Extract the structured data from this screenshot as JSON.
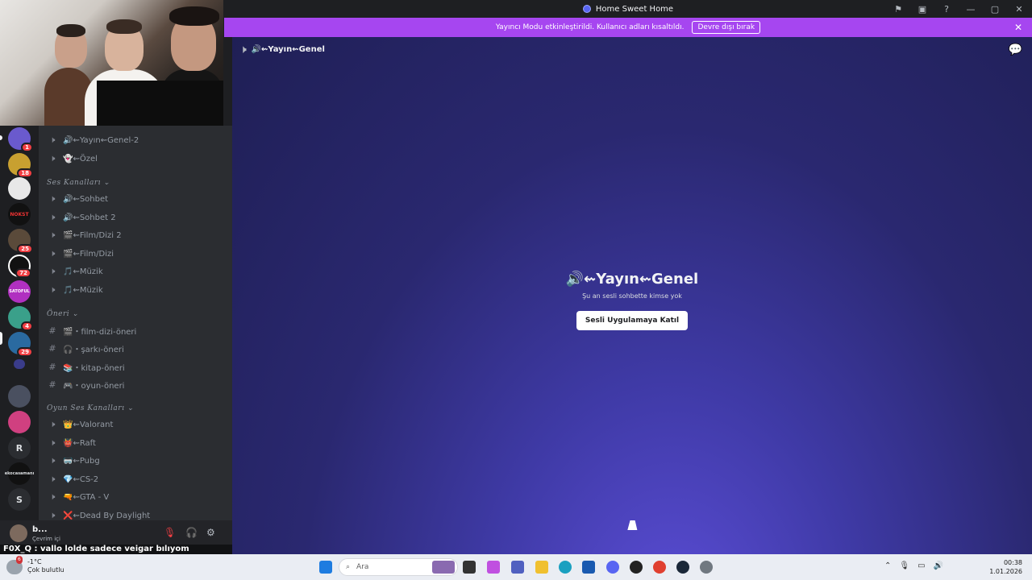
{
  "window": {
    "title": "Home Sweet Home"
  },
  "banner": {
    "text": "Yayıncı Modu etkinleştirildi. Kullanıcı adları kısaltıldı.",
    "button": "Devre dışı bırak"
  },
  "sidebar": {
    "channels_top": [
      {
        "icon": "speaker-icon",
        "label": "🔊⇜Yayın⇜Genel-2"
      },
      {
        "icon": "speaker-icon",
        "label": "👻⇜Özel"
      }
    ],
    "categories": [
      {
        "name": "Ses Kanalları",
        "channels": [
          {
            "icon": "speaker-icon",
            "label": "🔊⇜Sohbet"
          },
          {
            "icon": "speaker-icon",
            "label": "🔊⇜Sohbet 2"
          },
          {
            "icon": "speaker-icon",
            "label": "🎬⇜Film/Dizi 2"
          },
          {
            "icon": "speaker-icon",
            "label": "🎬⇜Film/Dizi"
          },
          {
            "icon": "speaker-icon",
            "label": "🎵⇜Müzik"
          },
          {
            "icon": "speaker-icon",
            "label": "🎵⇜Müzik"
          }
        ]
      },
      {
        "name": "Öneri",
        "channels": [
          {
            "icon": "hash-icon",
            "label": "🎬・film-dizi-öneri"
          },
          {
            "icon": "hash-icon",
            "label": "🎧・şarkı-öneri"
          },
          {
            "icon": "hash-icon",
            "label": "📚・kitap-öneri"
          },
          {
            "icon": "hash-icon",
            "label": "🎮・oyun-öneri"
          }
        ]
      },
      {
        "name": "Oyun Ses Kanalları",
        "channels": [
          {
            "icon": "speaker-icon",
            "label": "👑⇜Valorant"
          },
          {
            "icon": "speaker-icon",
            "label": "👹⇜Raft"
          },
          {
            "icon": "speaker-icon",
            "label": "🥽⇜Pubg"
          },
          {
            "icon": "speaker-icon",
            "label": "💎⇜CS-2"
          },
          {
            "icon": "speaker-icon",
            "label": "🔫⇜GTA - V"
          },
          {
            "icon": "speaker-icon",
            "label": "❌⇜Dead By Daylight"
          }
        ]
      }
    ]
  },
  "servers": {
    "badges": [
      "1",
      "18",
      "25",
      "72",
      "4",
      "29"
    ],
    "letters": [
      "R",
      "S"
    ],
    "labels": [
      "NOKST",
      "SATOFUL",
      "ekocasamanı"
    ]
  },
  "user": {
    "name": "b...",
    "status": "Çevrim içi"
  },
  "chat_overlay": {
    "text": "F0X_Q : vallo lolde sadece veigar bılıyom"
  },
  "main": {
    "channel_name": "🔊⇜Yayın⇜Genel",
    "empty_text": "Şu an sesli sohbette kimse yok",
    "join_button": "Sesli Uygulamaya Katıl"
  },
  "taskbar": {
    "weather_temp": "-1°C",
    "weather_desc": "Çok bulutlu",
    "weather_badge": "6",
    "search_placeholder": "Ara",
    "time": "00:38",
    "date": "1.01.2026"
  }
}
